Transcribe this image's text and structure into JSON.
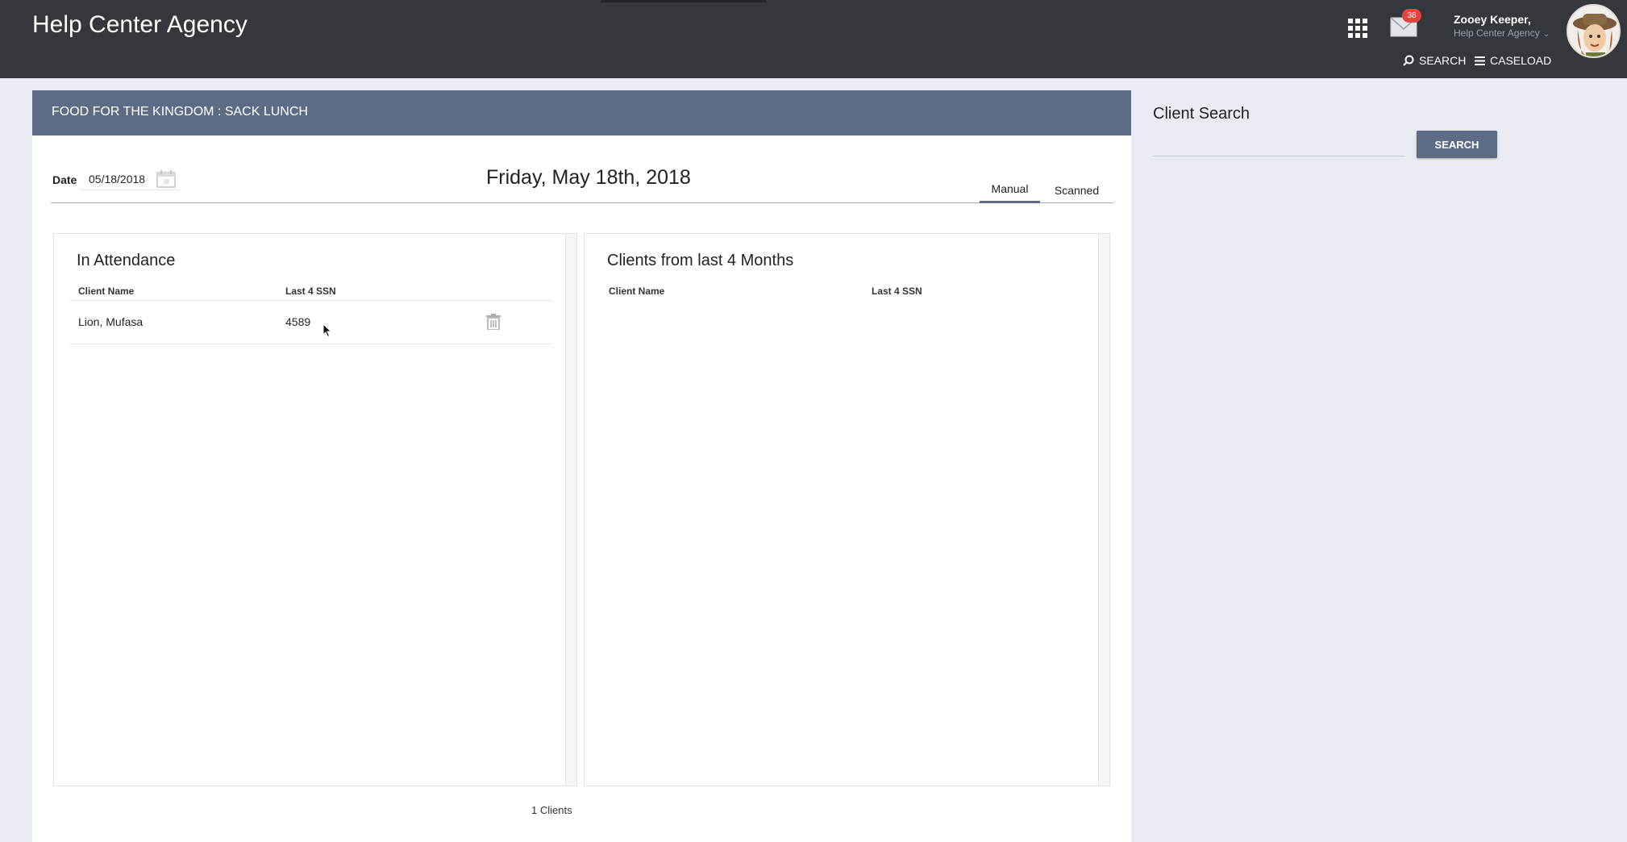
{
  "header": {
    "brand": "Help Center Agency",
    "mail_count": "38",
    "user_name": "Zooey Keeper,",
    "user_agency": "Help Center Agency",
    "nav": {
      "search": "SEARCH",
      "caseload": "CASELOAD"
    }
  },
  "program": {
    "title": "FOOD FOR THE KINGDOM : SACK LUNCH"
  },
  "date": {
    "label": "Date",
    "value": "05/18/2018",
    "heading": "Friday, May 18th, 2018"
  },
  "tabs": [
    {
      "label": "Manual",
      "active": true
    },
    {
      "label": "Scanned",
      "active": false
    }
  ],
  "attendance": {
    "title": "In Attendance",
    "columns": [
      "Client Name",
      "Last 4 SSN"
    ],
    "rows": [
      {
        "name": "Lion, Mufasa",
        "ssn": "4589"
      }
    ]
  },
  "recent": {
    "title": "Clients from last 4 Months",
    "columns": [
      "Client Name",
      "Last 4 SSN"
    ],
    "rows": []
  },
  "count_label": "1 Clients",
  "client_search": {
    "title": "Client Search",
    "placeholder": "",
    "button": "SEARCH"
  },
  "colors": {
    "header": "#34373c",
    "accent": "#5d6b85",
    "badge": "#e54242",
    "page": "#e8ebf1"
  },
  "icons": [
    "apps-grid-icon",
    "mail-icon",
    "chevron-down-icon",
    "search-icon",
    "menu-icon",
    "calendar-icon",
    "trash-icon",
    "mouse-cursor-icon"
  ]
}
